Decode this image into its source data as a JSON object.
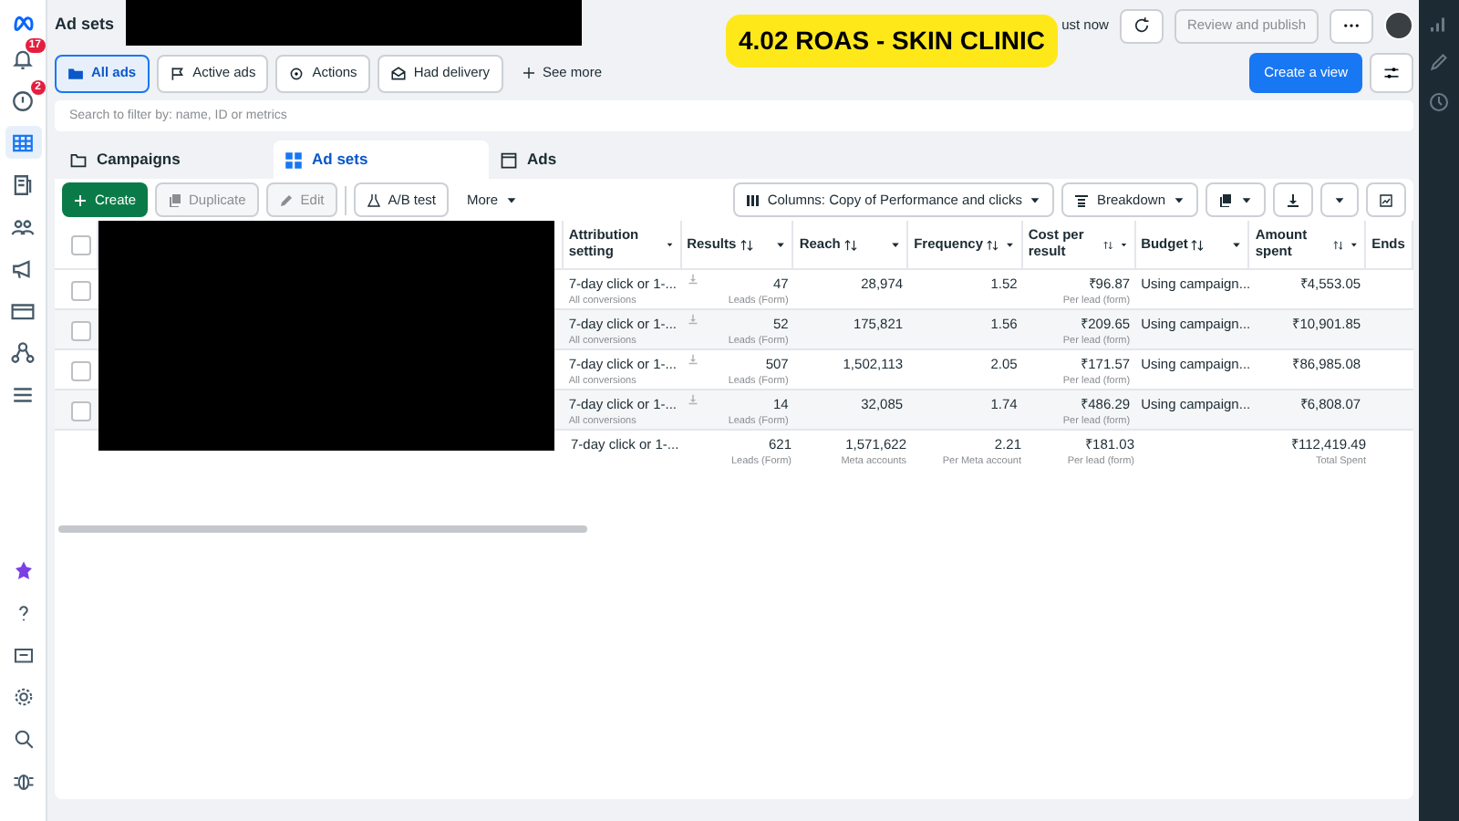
{
  "banner": "4.02 ROAS - SKIN CLINIC",
  "sidebar": {
    "top": [
      {
        "kind": "notifications",
        "badge": "17",
        "selected": false
      },
      {
        "kind": "alerts",
        "badge": "2",
        "selected": false
      },
      {
        "kind": "grid",
        "selected": true
      },
      {
        "kind": "pages",
        "selected": false
      },
      {
        "kind": "people",
        "selected": false
      },
      {
        "kind": "megaphone",
        "selected": false
      },
      {
        "kind": "card",
        "selected": false
      },
      {
        "kind": "network",
        "selected": false
      },
      {
        "kind": "menu",
        "selected": false
      }
    ]
  },
  "header": {
    "title": "Ad sets",
    "status": "ust now",
    "review_button": {
      "label": "Review and publish",
      "disabled": true
    }
  },
  "filters": [
    {
      "label": "All ads",
      "selected": true
    },
    {
      "label": "Active ads",
      "selected": false
    },
    {
      "label": "Actions",
      "selected": false
    },
    {
      "label": "Had delivery",
      "selected": false
    }
  ],
  "see_more": "See more",
  "create_view": "Create a view",
  "search": {
    "placeholder": "Search to filter by: name, ID or metrics"
  },
  "level_tabs": [
    {
      "label": "Campaigns",
      "selected": false
    },
    {
      "label": "Ad sets",
      "selected": true
    },
    {
      "label": "Ads",
      "selected": false
    }
  ],
  "toolbar": {
    "buttons": [
      {
        "kind": "create",
        "label": "Create",
        "disabled": false
      },
      {
        "kind": "duplicate",
        "label": "Duplicate",
        "disabled": true
      },
      {
        "kind": "edit",
        "label": "Edit",
        "disabled": true
      },
      {
        "kind": "abtest",
        "label": "A/B test",
        "disabled": false
      }
    ],
    "more": "More",
    "columns": "Columns: Copy of Performance and clicks",
    "breakdown": "Breakdown"
  },
  "table": {
    "select_all": {
      "checked": false
    },
    "columns": [
      {
        "label": "Attribution setting",
        "sortable": false,
        "menu": true
      },
      {
        "label": "Results",
        "sortable": true,
        "menu": true
      },
      {
        "label": "Reach",
        "sortable": true,
        "menu": true
      },
      {
        "label": "Frequency",
        "sortable": true,
        "menu": true
      },
      {
        "label": "Cost per result",
        "sortable": true,
        "menu": true
      },
      {
        "label": "Budget",
        "sortable": true,
        "menu": true
      },
      {
        "label": "Amount spent",
        "sortable": true,
        "menu": true
      },
      {
        "label": "Ends"
      }
    ],
    "rows": [
      {
        "checked": false,
        "attribution": "7-day click or 1-...",
        "attribution_note": "All conversions",
        "results": "47",
        "results_note": "Leads (Form)",
        "reach": "28,974",
        "frequency": "1.52",
        "cost": "₹96.87",
        "cost_note": "Per lead (form)",
        "budget": "Using campaign...",
        "spent": "₹4,553.05"
      },
      {
        "checked": false,
        "attribution": "7-day click or 1-...",
        "attribution_note": "All conversions",
        "results": "52",
        "results_note": "Leads (Form)",
        "reach": "175,821",
        "frequency": "1.56",
        "cost": "₹209.65",
        "cost_note": "Per lead (form)",
        "budget": "Using campaign...",
        "spent": "₹10,901.85"
      },
      {
        "checked": false,
        "attribution": "7-day click or 1-...",
        "attribution_note": "All conversions",
        "results": "507",
        "results_note": "Leads (Form)",
        "reach": "1,502,113",
        "frequency": "2.05",
        "cost": "₹171.57",
        "cost_note": "Per lead (form)",
        "budget": "Using campaign...",
        "spent": "₹86,985.08"
      },
      {
        "checked": false,
        "attribution": "7-day click or 1-...",
        "attribution_note": "All conversions",
        "results": "14",
        "results_note": "Leads (Form)",
        "reach": "32,085",
        "frequency": "1.74",
        "cost": "₹486.29",
        "cost_note": "Per lead (form)",
        "budget": "Using campaign...",
        "spent": "₹6,808.07"
      }
    ],
    "summary": {
      "attribution": "7-day click or 1-...",
      "results": "621",
      "results_note": "Leads (Form)",
      "reach": "1,571,622",
      "reach_note": "Meta accounts",
      "frequency": "2.21",
      "frequency_note": "Per Meta account",
      "cost": "₹181.03",
      "cost_note": "Per lead (form)",
      "spent": "₹112,419.49",
      "spent_note": "Total Spent"
    }
  }
}
